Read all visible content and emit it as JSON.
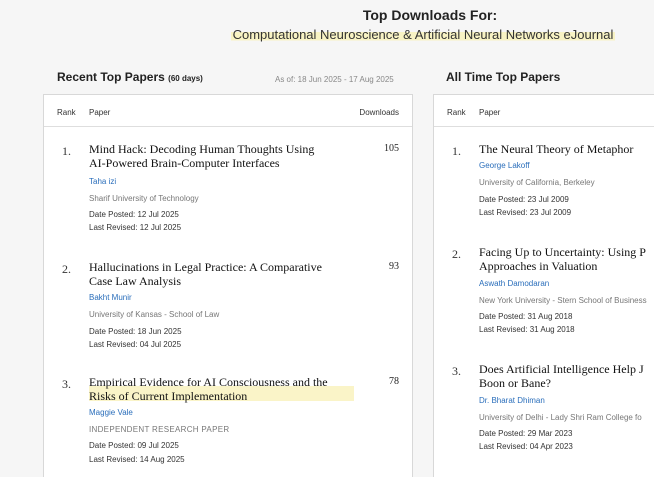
{
  "header": {
    "title": "Top Downloads For:",
    "journal": "Computational Neuroscience & Artificial Neural Networks eJournal"
  },
  "recent": {
    "heading": "Recent Top Papers",
    "days": "(60 days)",
    "as_of": "As of: 18 Jun 2025 - 17 Aug 2025",
    "columns": {
      "rank": "Rank",
      "paper": "Paper",
      "downloads": "Downloads"
    },
    "papers": [
      {
        "rank": "1.",
        "title": "Mind Hack: Decoding Human Thoughts Using\nAI-Powered Brain-Computer Interfaces",
        "downloads": "105",
        "author": "Taha izi",
        "affiliation": "Sharif University of Technology",
        "date_posted": "Date Posted: 12 Jul 2025",
        "last_revised": "Last Revised: 12 Jul 2025"
      },
      {
        "rank": "2.",
        "title": "Hallucinations in Legal Practice: A Comparative\nCase Law Analysis",
        "downloads": "93",
        "author": "Bakht Munir",
        "affiliation": "University of Kansas - School of Law",
        "date_posted": "Date Posted: 18 Jun 2025",
        "last_revised": "Last Revised: 04 Jul 2025"
      },
      {
        "rank": "3.",
        "title": "Empirical Evidence for AI Consciousness and the\nRisks of Current Implementation",
        "downloads": "78",
        "author": "Maggie Vale",
        "affiliation": "INDEPENDENT RESEARCH PAPER",
        "date_posted": "Date Posted: 09 Jul 2025",
        "last_revised": "Last Revised: 14 Aug 2025"
      }
    ]
  },
  "alltime": {
    "heading": "All Time Top Papers",
    "columns": {
      "rank": "Rank",
      "paper": "Paper"
    },
    "papers": [
      {
        "rank": "1.",
        "title": "The Neural Theory of Metaphor",
        "author": "George Lakoff",
        "affiliation": "University of California, Berkeley",
        "date_posted": "Date Posted: 23 Jul 2009",
        "last_revised": "Last Revised: 23 Jul 2009"
      },
      {
        "rank": "2.",
        "title": "Facing Up to Uncertainty: Using P\nApproaches in Valuation",
        "author": "Aswath Damodaran",
        "affiliation": "New York University - Stern School of Business",
        "date_posted": "Date Posted: 31 Aug 2018",
        "last_revised": "Last Revised: 31 Aug 2018"
      },
      {
        "rank": "3.",
        "title": "Does Artificial Intelligence Help J\nBoon or Bane?",
        "author": "Dr. Bharat Dhiman",
        "affiliation": "University of Delhi - Lady Shri Ram College fo",
        "date_posted": "Date Posted: 29 Mar 2023",
        "last_revised": "Last Revised: 04 Apr 2023"
      }
    ]
  }
}
